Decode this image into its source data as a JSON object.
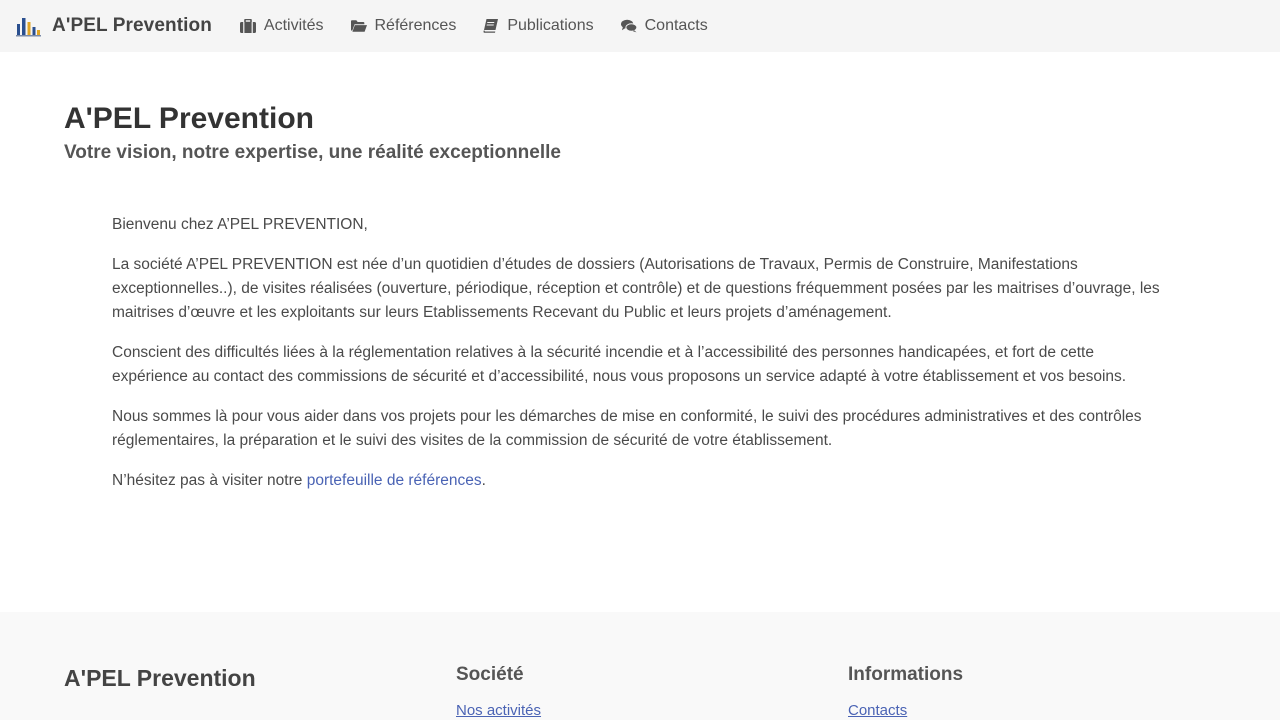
{
  "navbar": {
    "brand": "A'PEL Prevention",
    "logo_icon": "building-chart-logo",
    "items": [
      {
        "label": "Activités",
        "icon": "briefcase-icon"
      },
      {
        "label": "Références",
        "icon": "folder-open-icon"
      },
      {
        "label": "Publications",
        "icon": "book-icon"
      },
      {
        "label": "Contacts",
        "icon": "comments-icon"
      }
    ]
  },
  "hero": {
    "title": "A'PEL Prevention",
    "subtitle": "Votre vision, notre expertise, une réalité exceptionnelle"
  },
  "content": {
    "greeting": "Bienvenu chez A’PEL PREVENTION,",
    "paragraph1": "La société A’PEL PREVENTION est née d’un quotidien d’études de dossiers (Autorisations de Travaux, Permis de Construire, Manifestations exceptionnelles..), de visites réalisées (ouverture, périodique, réception et contrôle) et de questions fréquemment posées par les maitrises d’ouvrage, les maitrises d’œuvre et les exploitants sur leurs Etablissements Recevant du Public et leurs projets d’aménagement.",
    "paragraph2": "Conscient des difficultés liées à la réglementation relatives à la sécurité incendie et à l’accessibilité des personnes handicapées, et fort de cette expérience au contact des commissions de sécurité et d’accessibilité, nous vous proposons un service adapté à votre établissement et vos besoins.",
    "paragraph3": "Nous sommes là pour vous aider dans vos projets pour les démarches de mise en conformité, le suivi des procédures administratives et des contrôles réglementaires, la préparation et le suivi des visites de la commission de sécurité de votre établissement.",
    "closing_prefix": "N’hésitez pas à visiter notre ",
    "closing_link": "portefeuille de références",
    "closing_suffix": "."
  },
  "footer": {
    "brand": "A'PEL Prevention",
    "societe": {
      "heading": "Société",
      "link": "Nos activités"
    },
    "informations": {
      "heading": "Informations",
      "link": "Contacts"
    }
  },
  "colors": {
    "navbar_bg": "#f5f5f5",
    "link": "#4a63b4",
    "text": "#4a4a4a",
    "footer_bg": "#f9f9f9"
  }
}
